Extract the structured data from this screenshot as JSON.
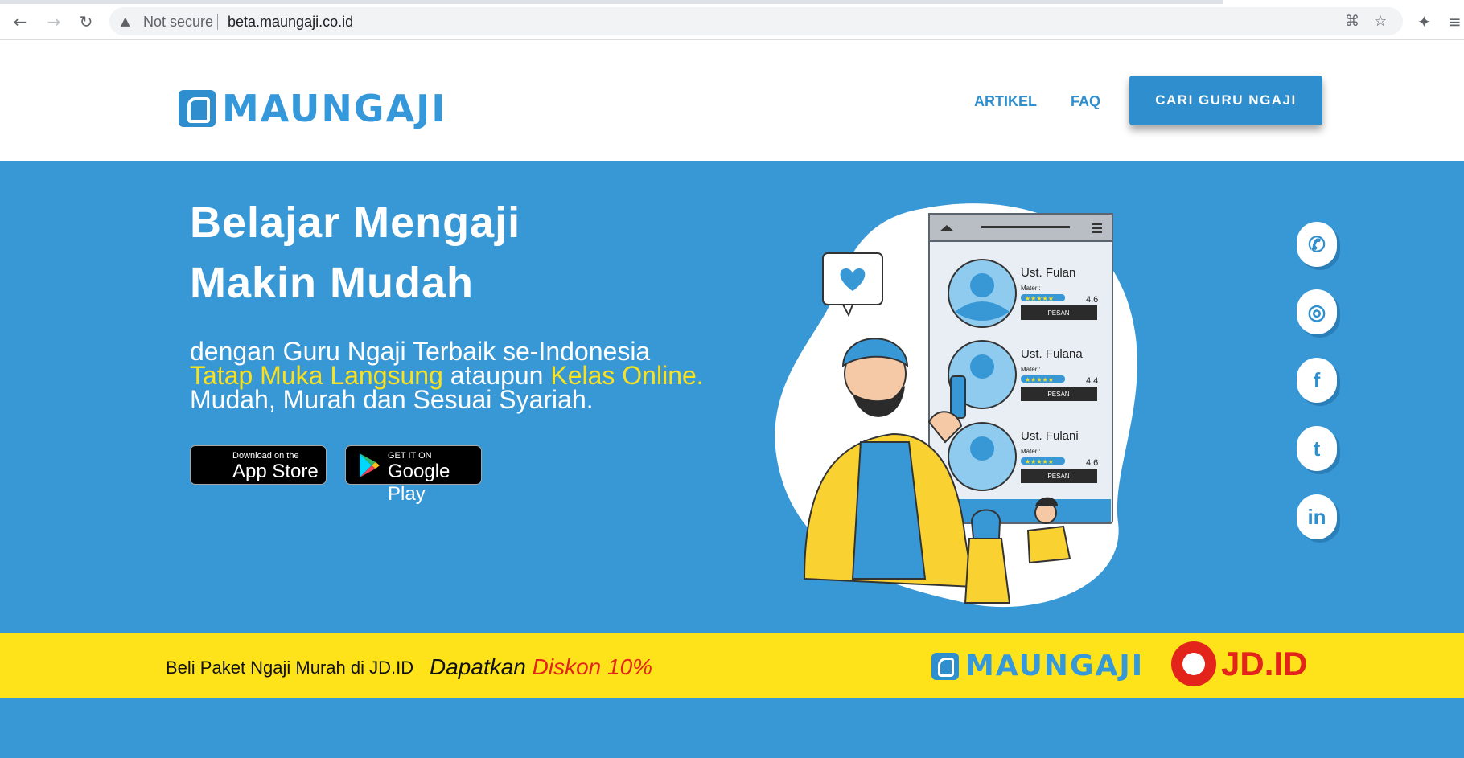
{
  "browser": {
    "security_label": "Not secure",
    "url": "beta.maungaji.co.id"
  },
  "header": {
    "logo_text": "MAUNGAJI",
    "nav": [
      "ARTIKEL",
      "FAQ"
    ],
    "cta": "CARI GURU NGAJI"
  },
  "hero": {
    "title_line1": "Belajar Mengaji",
    "title_line2": "Makin Mudah",
    "sub_line1": "dengan Guru Ngaji Terbaik se-Indonesia",
    "sub_hl1": "Tatap Muka Langsung",
    "sub_mid": " ataupun ",
    "sub_hl2": "Kelas Online.",
    "sub_line3": "Mudah, Murah dan Sesuai Syariah.",
    "appstore_small": "Download on the",
    "appstore_big": "App Store",
    "play_small": "GET IT ON",
    "play_big": "Google Play"
  },
  "illustration": {
    "teachers": [
      {
        "name": "Ust. Fulan",
        "materi": "Materi:",
        "rating": "4.6",
        "button": "PESAN"
      },
      {
        "name": "Ust. Fulana",
        "materi": "Materi:",
        "rating": "4.4",
        "button": "PESAN"
      },
      {
        "name": "Ust. Fulani",
        "materi": "Materi:",
        "rating": "4.6",
        "button": "PESAN"
      }
    ]
  },
  "social": [
    "whatsapp-icon",
    "instagram-icon",
    "facebook-icon",
    "twitter-icon",
    "linkedin-icon"
  ],
  "banner": {
    "text": "Beli Paket Ngaji Murah di JD.ID",
    "promo_prefix": "Dapatkan",
    "promo_highlight": "Diskon 10%",
    "logo_text": "MAUNGAJI",
    "jd_text": "JD.ID"
  },
  "colors": {
    "primary": "#3898d6",
    "accent_yellow": "#f9e11e",
    "banner_yellow": "#ffe31a",
    "jd_red": "#e3241b"
  }
}
